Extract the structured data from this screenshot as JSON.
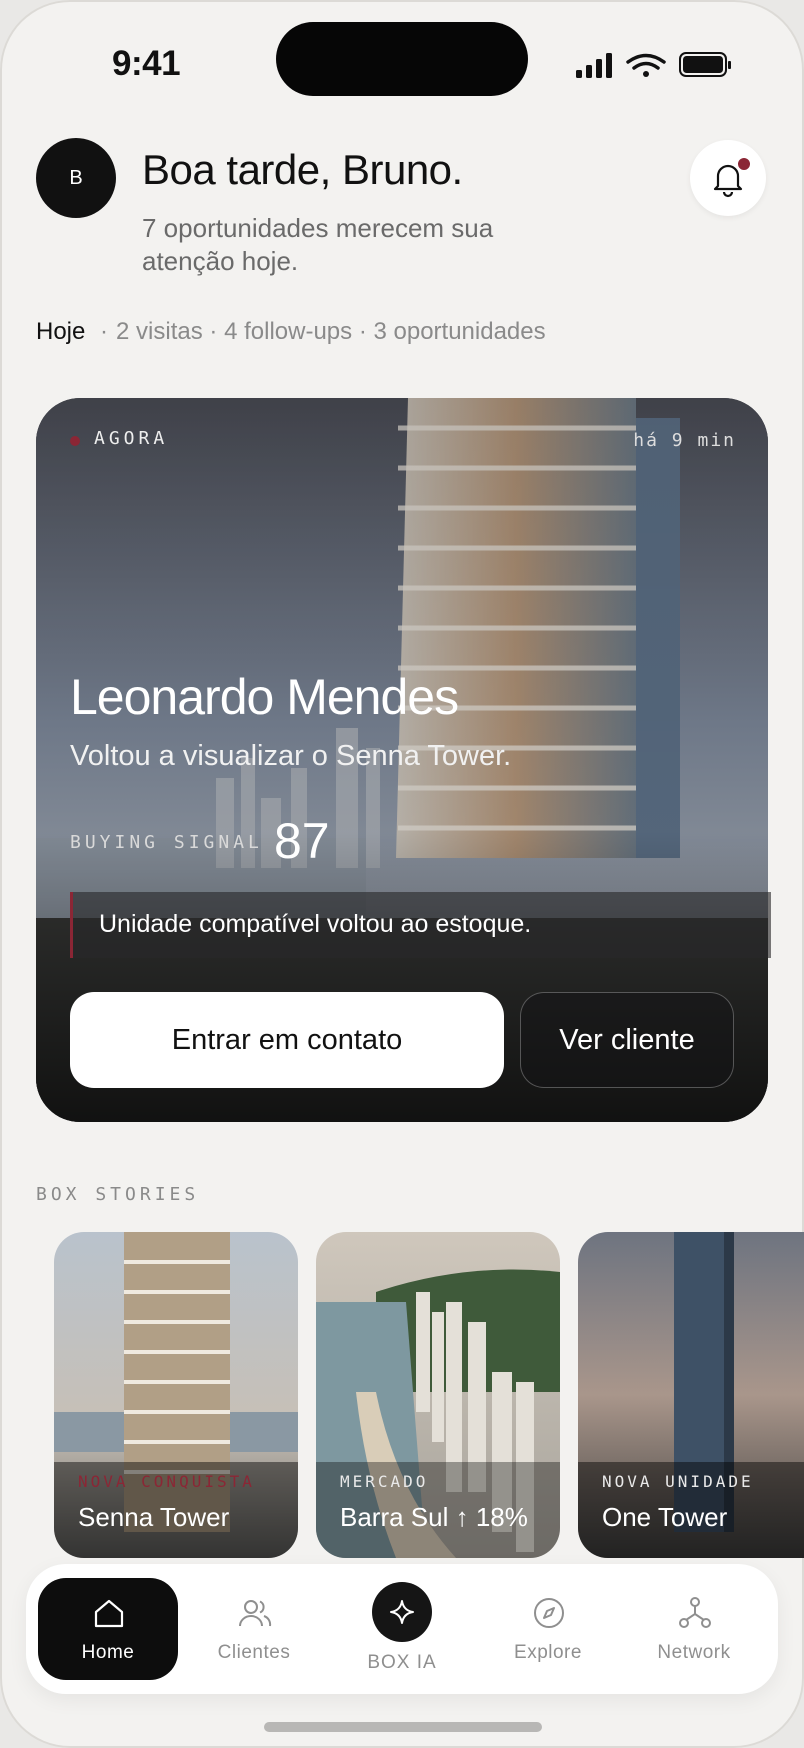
{
  "status_bar": {
    "time": "9:41"
  },
  "header": {
    "avatar_initial": "B",
    "greeting": "Boa tarde, Bruno.",
    "subtitle": "7 oportunidades merecem sua atenção hoje."
  },
  "summary": {
    "today": "Hoje",
    "visits": "2 visitas",
    "followups": "4 follow-ups",
    "opportunities": "3 oportunidades",
    "separator": "·"
  },
  "hero": {
    "status": "AGORA",
    "time_ago": "há 9 min",
    "client_name": "Leonardo Mendes",
    "description": "Voltou a visualizar o Senna Tower.",
    "signal_label": "BUYING SIGNAL",
    "signal_value": "87",
    "notice": "Unidade compatível voltou ao estoque.",
    "primary_button": "Entrar em contato",
    "secondary_button": "Ver cliente"
  },
  "stories": {
    "label": "BOX STORIES",
    "items": [
      {
        "tag": "NOVA CONQUISTA",
        "title": "Senna Tower"
      },
      {
        "tag": "MERCADO",
        "title": "Barra Sul ↑ 18%"
      },
      {
        "tag": "NOVA UNIDADE",
        "title": "One Tower"
      }
    ]
  },
  "tabbar": {
    "items": [
      {
        "label": "Home",
        "icon": "home-icon"
      },
      {
        "label": "Clientes",
        "icon": "users-icon"
      },
      {
        "label": "BOX IA",
        "icon": "sparkle-icon"
      },
      {
        "label": "Explore",
        "icon": "compass-icon"
      },
      {
        "label": "Network",
        "icon": "network-icon"
      }
    ]
  },
  "colors": {
    "accent": "#8b2635",
    "background": "#f3f2f0",
    "dark": "#0d0d0d"
  }
}
